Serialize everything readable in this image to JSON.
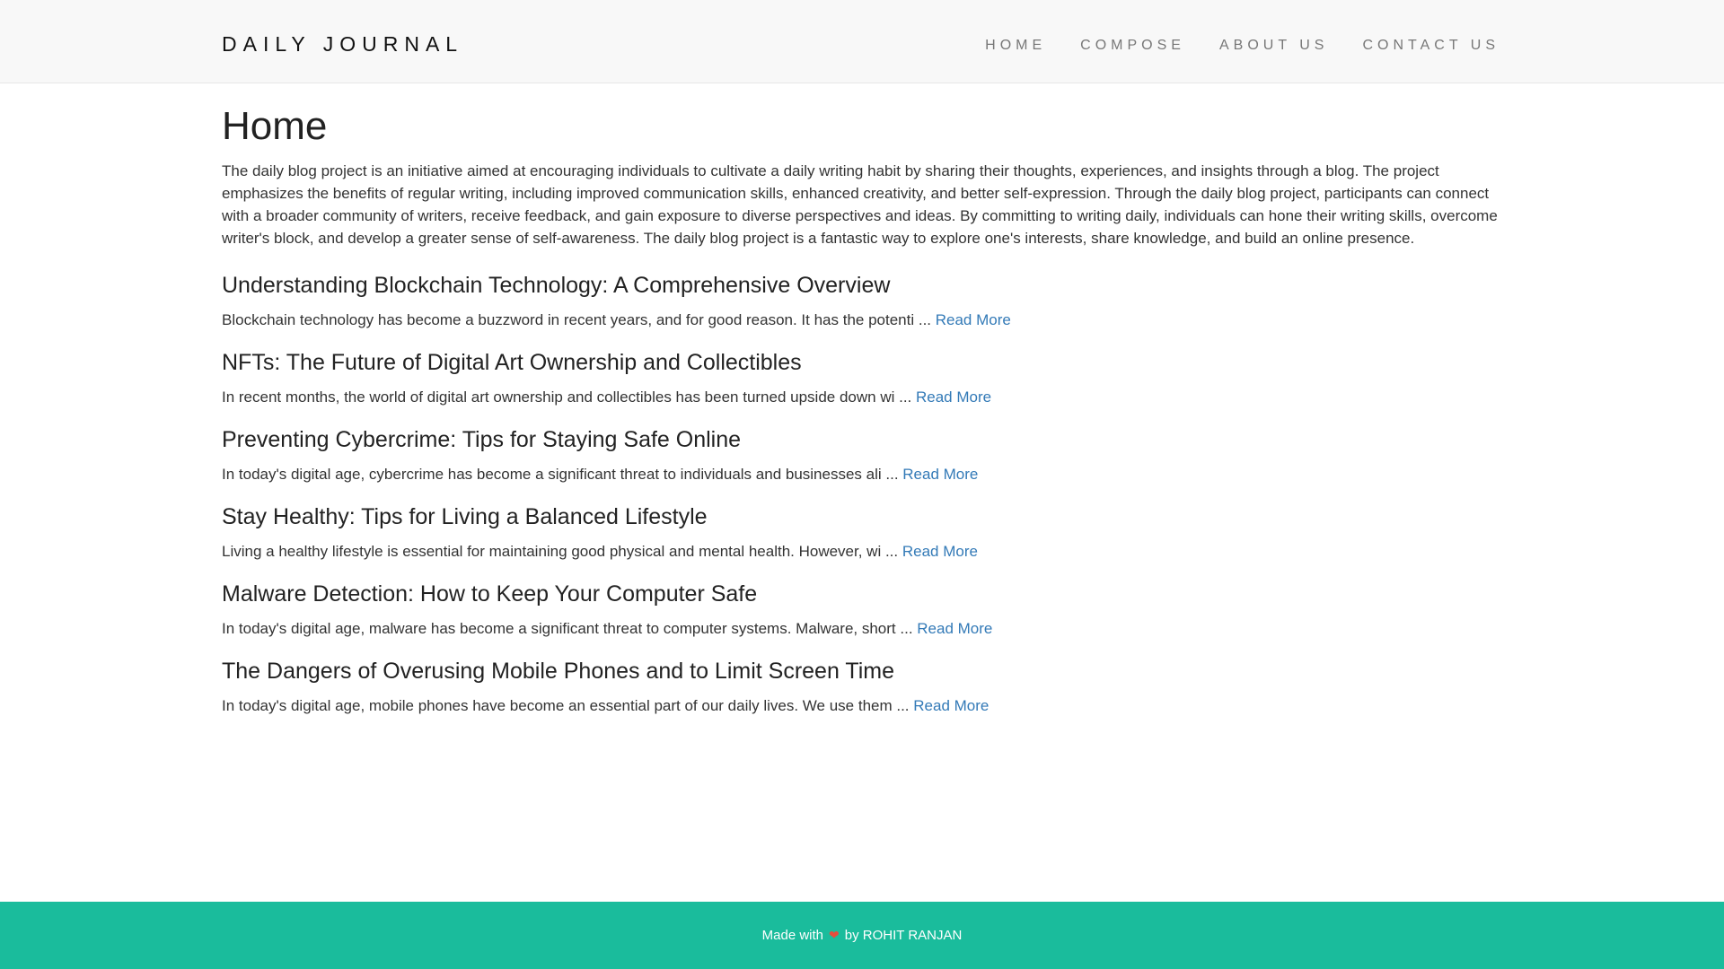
{
  "nav": {
    "brand": "DAILY JOURNAL",
    "links": [
      "HOME",
      "COMPOSE",
      "ABOUT US",
      "CONTACT US"
    ]
  },
  "main": {
    "title": "Home",
    "intro": "The daily blog project is an initiative aimed at encouraging individuals to cultivate a daily writing habit by sharing their thoughts, experiences, and insights through a blog. The project emphasizes the benefits of regular writing, including improved communication skills, enhanced creativity, and better self-expression. Through the daily blog project, participants can connect with a broader community of writers, receive feedback, and gain exposure to diverse perspectives and ideas. By committing to writing daily, individuals can hone their writing skills, overcome writer's block, and develop a greater sense of self-awareness. The daily blog project is a fantastic way to explore one's interests, share knowledge, and build an online presence.",
    "read_more_label": "Read More",
    "posts": [
      {
        "title": "Understanding Blockchain Technology: A Comprehensive Overview",
        "excerpt": "Blockchain technology has become a buzzword in recent years, and for good reason. It has the potenti ... "
      },
      {
        "title": "NFTs: The Future of Digital Art Ownership and Collectibles",
        "excerpt": "In recent months, the world of digital art ownership and collectibles has been turned upside down wi ... "
      },
      {
        "title": "Preventing Cybercrime: Tips for Staying Safe Online",
        "excerpt": "In today's digital age, cybercrime has become a significant threat to individuals and businesses ali ... "
      },
      {
        "title": "Stay Healthy: Tips for Living a Balanced Lifestyle",
        "excerpt": "Living a healthy lifestyle is essential for maintaining good physical and mental health. However, wi ... "
      },
      {
        "title": "Malware Detection: How to Keep Your Computer Safe",
        "excerpt": "In today's digital age, malware has become a significant threat to computer systems. Malware, short ... "
      },
      {
        "title": "The Dangers of Overusing Mobile Phones and to Limit Screen Time",
        "excerpt": "In today's digital age, mobile phones have become an essential part of our daily lives. We use them ... "
      }
    ]
  },
  "footer": {
    "prefix": "Made with",
    "heart": "❤",
    "suffix": "by ROHIT RANJAN"
  },
  "colors": {
    "navbar_bg": "#f8f8f8",
    "link": "#337ab7",
    "footer_bg": "#1abc9c",
    "heart": "#e74c3c"
  }
}
